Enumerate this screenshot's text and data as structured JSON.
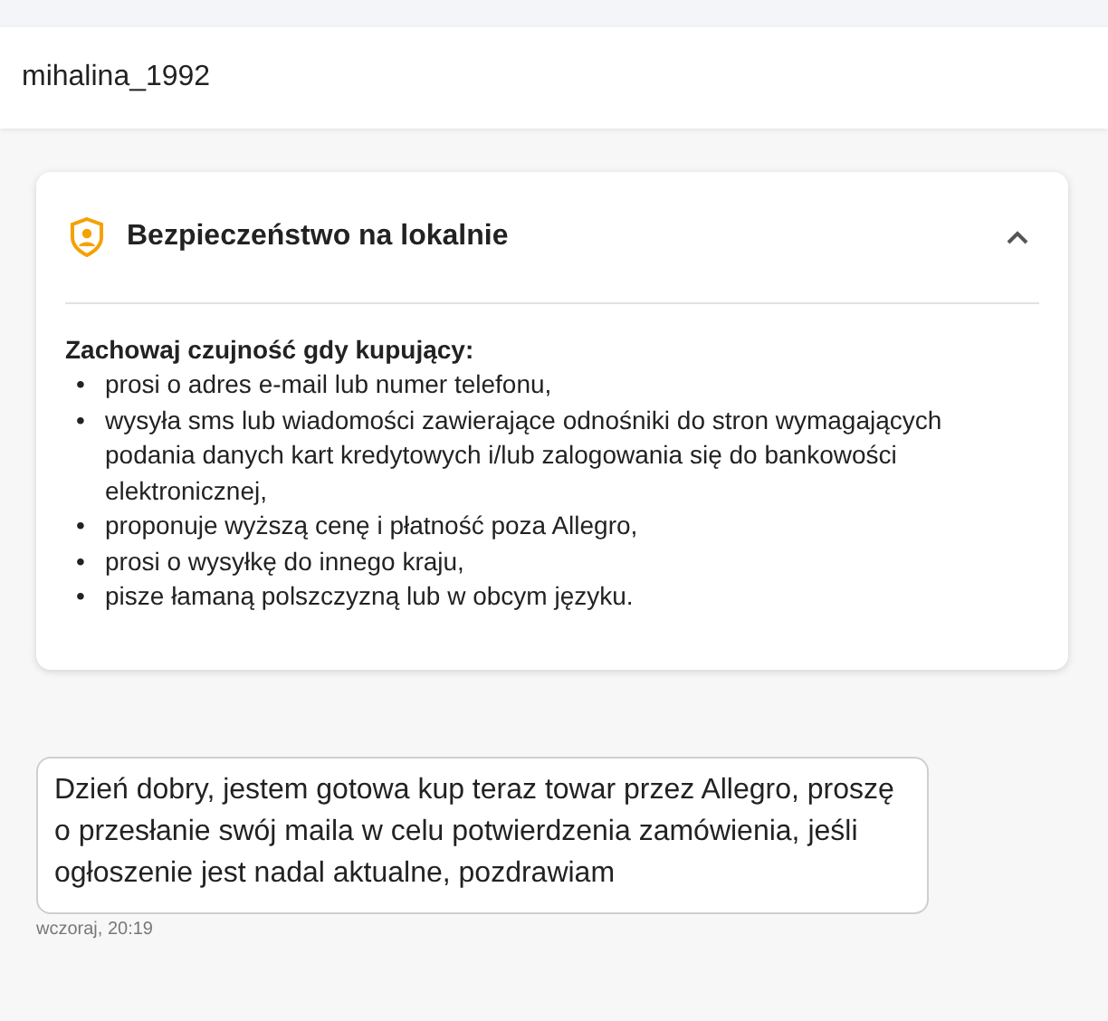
{
  "header": {
    "username": "mihalina_1992"
  },
  "safety_card": {
    "title": "Bezpieczeństwo na lokalnie",
    "expanded": true,
    "intro": "Zachowaj czujność gdy kupujący:",
    "items": [
      {
        "bullet": "•",
        "text": "prosi o adres e-mail lub numer telefonu,"
      },
      {
        "bullet": "•",
        "text": "wysyła sms lub wiadomości zawierające odnośniki do stron wymagających podania danych kart kredytowych i/lub zalogowania się do bankowości elektronicznej,"
      },
      {
        "bullet": "•",
        "text": "proponuje wyższą cenę i płatność poza Allegro,"
      },
      {
        "bullet": "•",
        "text": "prosi o wysyłkę do innego kraju,"
      },
      {
        "bullet": "•",
        "text": "pisze łamaną polszczyzną lub w obcym języku."
      }
    ]
  },
  "messages": [
    {
      "text": "Dzień dobry, jestem gotowa kup teraz towar przez Allegro, proszę o przesłanie swój maila w celu potwierdzenia zamówienia, jeśli ogłoszenie jest nadal aktualne, pozdrawiam",
      "time": "wczoraj, 20:19"
    }
  ]
}
